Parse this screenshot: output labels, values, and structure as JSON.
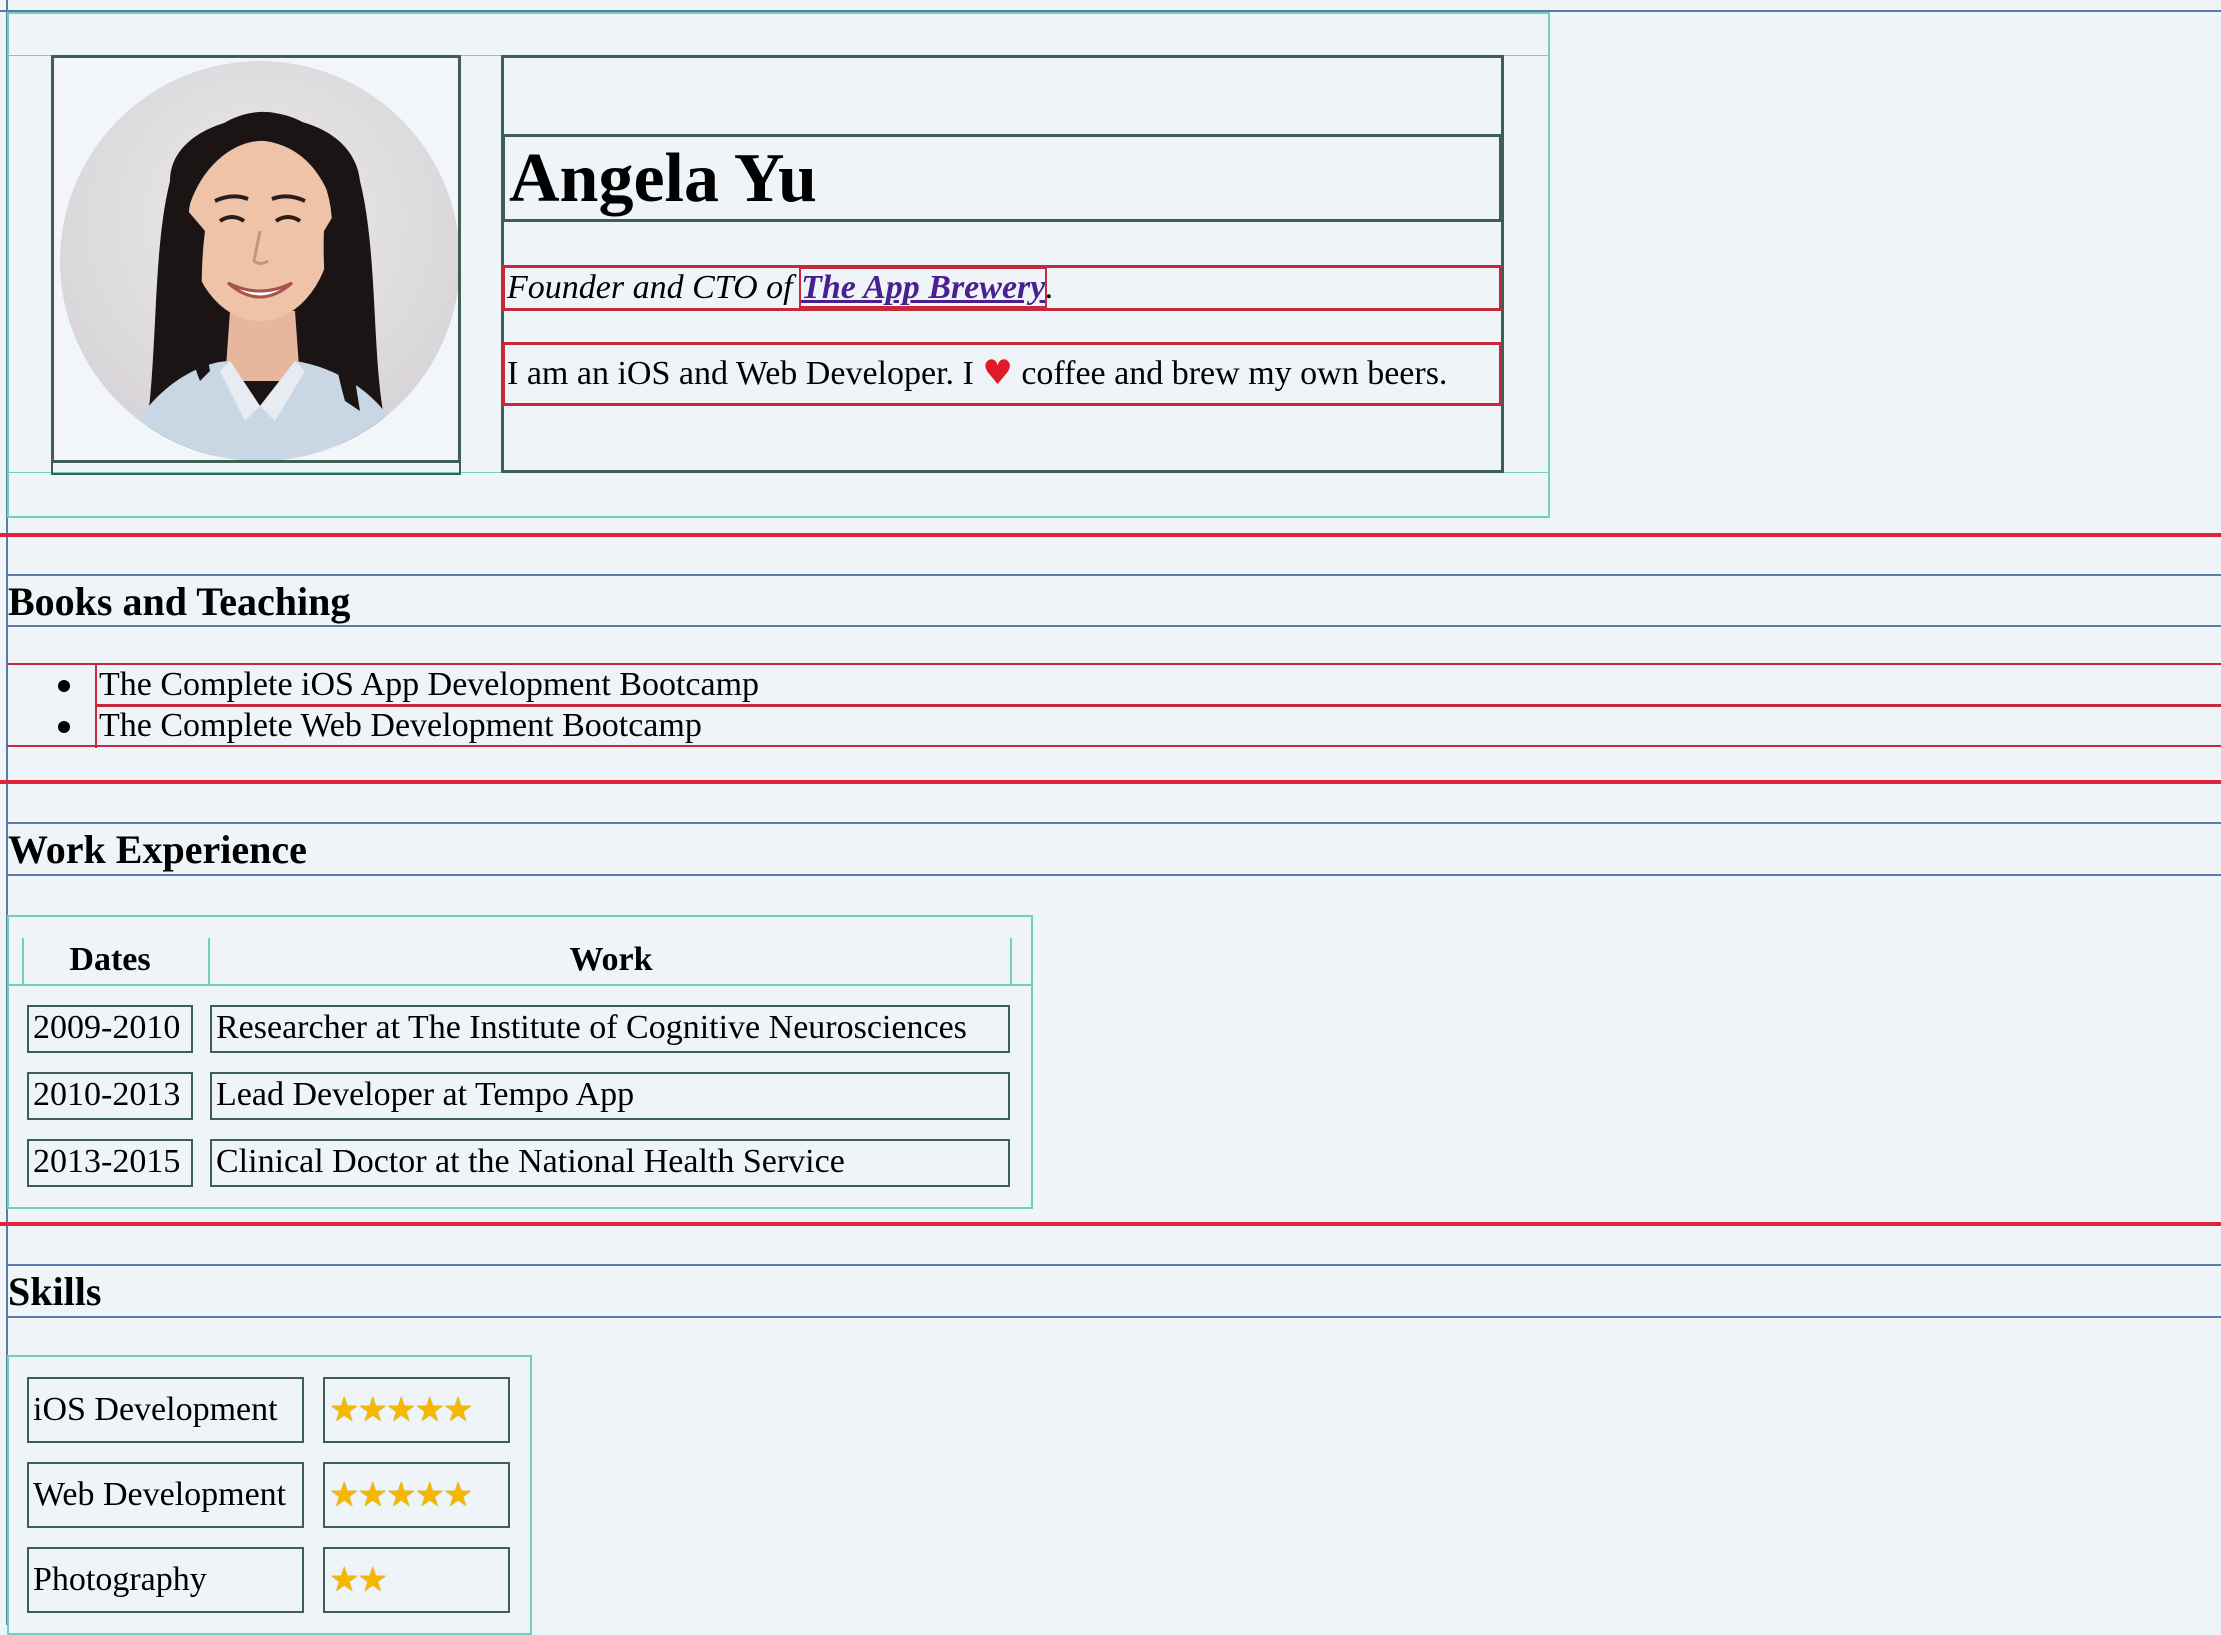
{
  "profile": {
    "name": "Angela Yu",
    "tagline_prefix": "Founder and CTO of ",
    "tagline_link": "The App Brewery",
    "tagline_suffix": ".",
    "bio_before": "I am an iOS and Web Developer. I ",
    "bio_after": " coffee and brew my own beers.",
    "heart_icon": "heart-icon"
  },
  "books": {
    "heading": "Books and Teaching",
    "items": [
      "The Complete iOS App Development Bootcamp",
      "The Complete Web Development Bootcamp"
    ]
  },
  "work": {
    "heading": "Work Experience",
    "headers": [
      "Dates",
      "Work"
    ],
    "rows": [
      {
        "dates": "2009-2010",
        "work": "Researcher at The Institute of Cognitive Neurosciences"
      },
      {
        "dates": "2010-2013",
        "work": "Lead Developer at Tempo App"
      },
      {
        "dates": "2013-2015",
        "work": "Clinical Doctor at the National Health Service"
      }
    ]
  },
  "skills": {
    "heading": "Skills",
    "items": [
      {
        "name": "iOS Development",
        "stars": 5,
        "star_glyphs": "★★★★★"
      },
      {
        "name": "Web Development",
        "stars": 5,
        "star_glyphs": "★★★★★"
      },
      {
        "name": "Photography",
        "stars": 2,
        "star_glyphs": "★★"
      }
    ]
  },
  "colors": {
    "background": "#eef4f7",
    "link": "#4a1f8f",
    "divider": "#e0233a",
    "star": "#f5b800"
  }
}
